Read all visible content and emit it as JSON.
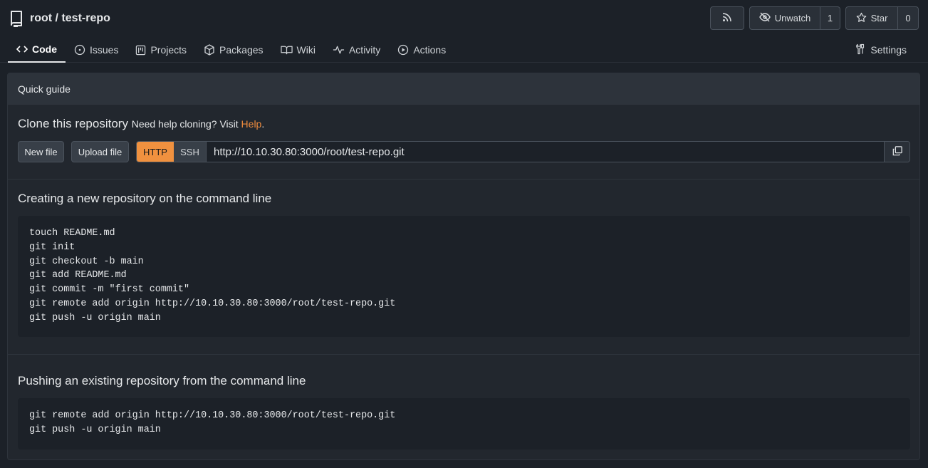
{
  "header": {
    "repo_title": "root / test-repo",
    "watch_label": "Unwatch",
    "watch_count": "1",
    "star_label": "Star",
    "star_count": "0"
  },
  "tabs": [
    {
      "label": "Code",
      "icon": "code-icon",
      "active": true
    },
    {
      "label": "Issues",
      "icon": "issue-icon"
    },
    {
      "label": "Projects",
      "icon": "project-icon"
    },
    {
      "label": "Packages",
      "icon": "package-icon"
    },
    {
      "label": "Wiki",
      "icon": "book-icon"
    },
    {
      "label": "Activity",
      "icon": "pulse-icon"
    },
    {
      "label": "Actions",
      "icon": "play-icon"
    }
  ],
  "settings_label": "Settings",
  "quick_guide": {
    "title": "Quick guide",
    "clone": {
      "heading": "Clone this repository",
      "help_prefix": "Need help cloning? Visit ",
      "help_link": "Help",
      "help_suffix": ".",
      "new_file": "New file",
      "upload_file": "Upload file",
      "http": "HTTP",
      "ssh": "SSH",
      "url": "http://10.10.30.80:3000/root/test-repo.git"
    },
    "new_repo": {
      "heading": "Creating a new repository on the command line",
      "code": "touch README.md\ngit init\ngit checkout -b main\ngit add README.md\ngit commit -m \"first commit\"\ngit remote add origin http://10.10.30.80:3000/root/test-repo.git\ngit push -u origin main"
    },
    "existing_repo": {
      "heading": "Pushing an existing repository from the command line",
      "code": "git remote add origin http://10.10.30.80:3000/root/test-repo.git\ngit push -u origin main"
    }
  },
  "colors": {
    "accent": "#f0913f",
    "background": "#1c2128",
    "panel": "#22272e"
  }
}
